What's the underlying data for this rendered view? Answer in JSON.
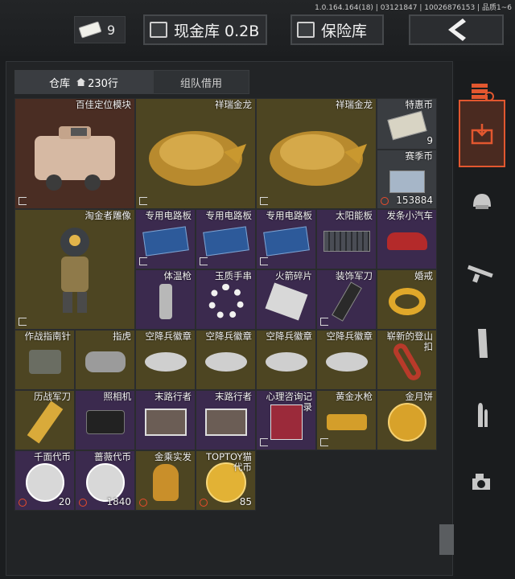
{
  "version": "1.0.164.164(18) | 03121847 | 10026876153 | 品质1~6",
  "topbar": {
    "ticket_count": "9",
    "cash_label": "现金库 0.2B",
    "safe_label": "保险库"
  },
  "tabs": {
    "warehouse": "仓库",
    "rows": "230行",
    "team": "组队借用"
  },
  "items": [
    {
      "name": "百佳定位模块",
      "count": "",
      "quality": "red"
    },
    {
      "name": "祥瑞金龙",
      "count": "",
      "quality": "gold"
    },
    {
      "name": "祥瑞金龙",
      "count": "",
      "quality": "gold"
    },
    {
      "name": "特惠币",
      "count": "9",
      "quality": "grey"
    },
    {
      "name": "赛季币",
      "count": "153884",
      "quality": "grey"
    },
    {
      "name": "淘金者雕像",
      "count": "",
      "quality": "gold"
    },
    {
      "name": "专用电路板",
      "count": "",
      "quality": "purple"
    },
    {
      "name": "专用电路板",
      "count": "",
      "quality": "purple"
    },
    {
      "name": "专用电路板",
      "count": "",
      "quality": "purple"
    },
    {
      "name": "太阳能板",
      "count": "",
      "quality": "purple"
    },
    {
      "name": "发条小汽车",
      "count": "",
      "quality": "purple"
    },
    {
      "name": "体温枪",
      "count": "",
      "quality": "purple"
    },
    {
      "name": "玉质手串",
      "count": "",
      "quality": "purple"
    },
    {
      "name": "火箭碎片",
      "count": "",
      "quality": "purple"
    },
    {
      "name": "装饰军刀",
      "count": "",
      "quality": "purple"
    },
    {
      "name": "婚戒",
      "count": "",
      "quality": "gold"
    },
    {
      "name": "作战指南针",
      "count": "",
      "quality": "gold"
    },
    {
      "name": "指虎",
      "count": "",
      "quality": "gold"
    },
    {
      "name": "空降兵徽章",
      "count": "",
      "quality": "gold"
    },
    {
      "name": "空降兵徽章",
      "count": "",
      "quality": "gold"
    },
    {
      "name": "空降兵徽章",
      "count": "",
      "quality": "gold"
    },
    {
      "name": "空降兵徽章",
      "count": "",
      "quality": "gold"
    },
    {
      "name": "崭新的登山扣",
      "count": "",
      "quality": "gold"
    },
    {
      "name": "历战军刀",
      "count": "",
      "quality": "gold"
    },
    {
      "name": "照相机",
      "count": "",
      "quality": "purple"
    },
    {
      "name": "末路行者",
      "count": "",
      "quality": "purple"
    },
    {
      "name": "末路行者",
      "count": "",
      "quality": "purple"
    },
    {
      "name": "心理咨询记录",
      "count": "",
      "quality": "purple"
    },
    {
      "name": "黄金水枪",
      "count": "",
      "quality": "gold"
    },
    {
      "name": "金月饼",
      "count": "",
      "quality": "gold"
    },
    {
      "name": "千面代币",
      "count": "20",
      "quality": "purple"
    },
    {
      "name": "蔷薇代币",
      "count": "1840",
      "quality": "purple"
    },
    {
      "name": "金乘实发",
      "count": "",
      "quality": "gold"
    },
    {
      "name": "TOPTOY猫代币",
      "count": "85",
      "quality": "gold"
    }
  ]
}
